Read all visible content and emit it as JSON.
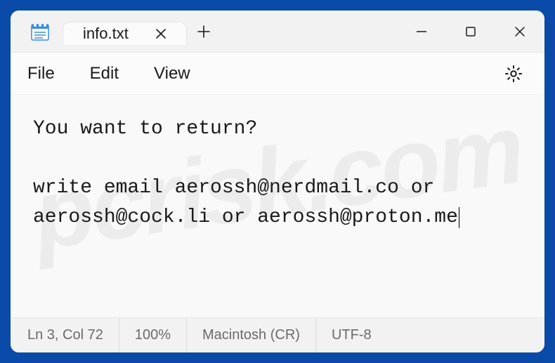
{
  "tab": {
    "title": "info.txt"
  },
  "menu": {
    "file": "File",
    "edit": "Edit",
    "view": "View"
  },
  "content": {
    "line1": "You want to return?",
    "line2": "",
    "line3": "write email aerossh@nerdmail.co or aerossh@cock.li or aerossh@proton.me"
  },
  "status": {
    "position": "Ln 3, Col 72",
    "zoom": "100%",
    "lineending": "Macintosh (CR)",
    "encoding": "UTF-8"
  },
  "watermark": "pcrisk.com"
}
